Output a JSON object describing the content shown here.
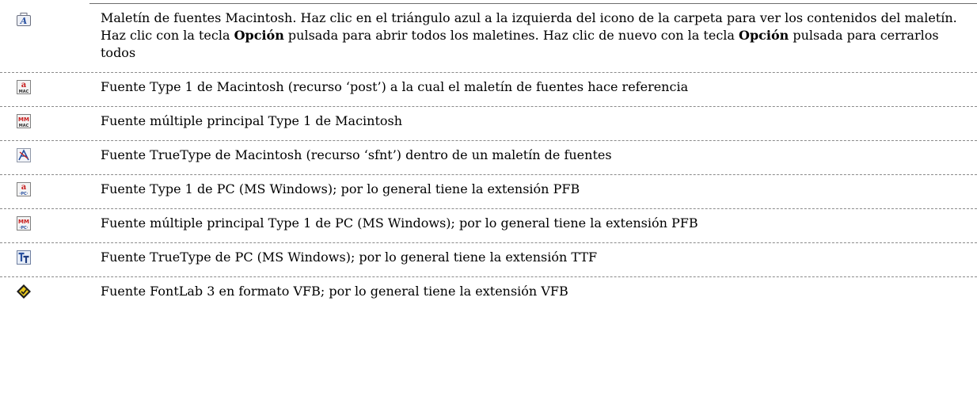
{
  "rows": [
    {
      "icon": "font-suitcase-icon",
      "text_parts": [
        "Maletín de fuentes Macintosh. Haz clic en el triángulo azul a la izquierda del icono de la carpeta para ver los contenidos del maletín. Haz clic con la tecla ",
        "Opción",
        " pulsada para abrir todos los maletines. Haz clic de nuevo con la tecla ",
        "Opción",
        " pulsada para cerrarlos todos"
      ]
    },
    {
      "icon": "mac-type1-font-icon",
      "text": "Fuente Type 1 de Macintosh (recurso ‘post’) a la cual el maletín de fuentes hace referencia",
      "icon_label": "MAC"
    },
    {
      "icon": "mac-multiple-master-font-icon",
      "text": "Fuente múltiple principal Type 1 de Macintosh",
      "icon_label": "MAC",
      "icon_mark": "MM"
    },
    {
      "icon": "mac-truetype-font-icon",
      "text": "Fuente TrueType de Macintosh (recurso ‘sfnt’) dentro de un maletín de fuentes"
    },
    {
      "icon": "pc-type1-font-icon",
      "text": "Fuente Type 1 de PC (MS Windows); por lo general tiene la extensión PFB",
      "icon_label": "·PC·"
    },
    {
      "icon": "pc-multiple-master-font-icon",
      "text": "Fuente múltiple principal Type 1 de PC (MS Windows); por lo general tiene la extensión PFB",
      "icon_label": "·PC·",
      "icon_mark": "MM"
    },
    {
      "icon": "pc-truetype-font-icon",
      "text": "Fuente TrueType de PC (MS Windows); por lo general tiene la extensión TTF"
    },
    {
      "icon": "fontlab-vfb-icon",
      "text": "Fuente FontLab 3 en formato VFB; por lo general tiene la extensión VFB"
    }
  ],
  "colors": {
    "text": "#000000",
    "rule": "#6e6e6e",
    "separator": "#8a8a8a",
    "type1_red": "#c81e1e",
    "truetype_blue": "#2850a0",
    "fontlab_yellow": "#e8c81e"
  }
}
